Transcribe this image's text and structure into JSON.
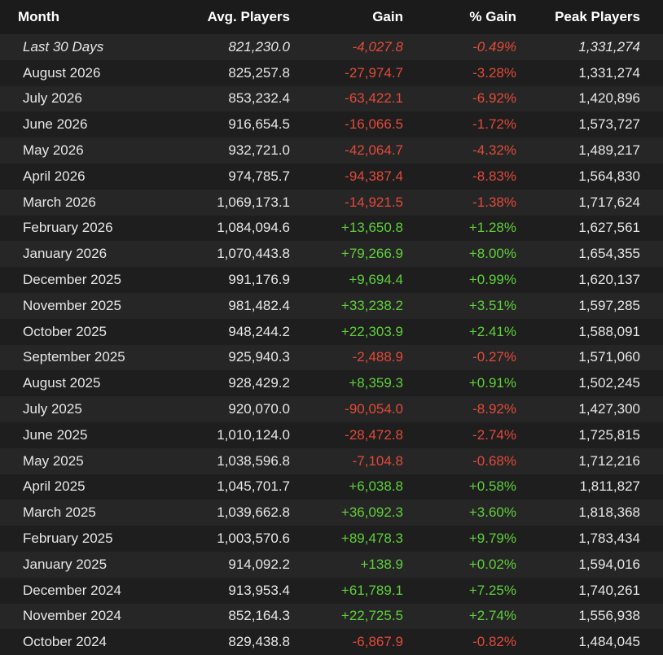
{
  "table": {
    "headers": {
      "month": "Month",
      "avg": "Avg. Players",
      "gain": "Gain",
      "pct": "% Gain",
      "peak": "Peak Players"
    },
    "rows": [
      {
        "month": "Last 30 Days",
        "avg": "821,230.0",
        "gain": "-4,027.8",
        "pct": "-0.49%",
        "peak": "1,331,274",
        "trend": "neg",
        "italic": true
      },
      {
        "month": "August 2026",
        "avg": "825,257.8",
        "gain": "-27,974.7",
        "pct": "-3.28%",
        "peak": "1,331,274",
        "trend": "neg"
      },
      {
        "month": "July 2026",
        "avg": "853,232.4",
        "gain": "-63,422.1",
        "pct": "-6.92%",
        "peak": "1,420,896",
        "trend": "neg"
      },
      {
        "month": "June 2026",
        "avg": "916,654.5",
        "gain": "-16,066.5",
        "pct": "-1.72%",
        "peak": "1,573,727",
        "trend": "neg"
      },
      {
        "month": "May 2026",
        "avg": "932,721.0",
        "gain": "-42,064.7",
        "pct": "-4.32%",
        "peak": "1,489,217",
        "trend": "neg"
      },
      {
        "month": "April 2026",
        "avg": "974,785.7",
        "gain": "-94,387.4",
        "pct": "-8.83%",
        "peak": "1,564,830",
        "trend": "neg"
      },
      {
        "month": "March 2026",
        "avg": "1,069,173.1",
        "gain": "-14,921.5",
        "pct": "-1.38%",
        "peak": "1,717,624",
        "trend": "neg"
      },
      {
        "month": "February 2026",
        "avg": "1,084,094.6",
        "gain": "+13,650.8",
        "pct": "+1.28%",
        "peak": "1,627,561",
        "trend": "pos"
      },
      {
        "month": "January 2026",
        "avg": "1,070,443.8",
        "gain": "+79,266.9",
        "pct": "+8.00%",
        "peak": "1,654,355",
        "trend": "pos"
      },
      {
        "month": "December 2025",
        "avg": "991,176.9",
        "gain": "+9,694.4",
        "pct": "+0.99%",
        "peak": "1,620,137",
        "trend": "pos"
      },
      {
        "month": "November 2025",
        "avg": "981,482.4",
        "gain": "+33,238.2",
        "pct": "+3.51%",
        "peak": "1,597,285",
        "trend": "pos"
      },
      {
        "month": "October 2025",
        "avg": "948,244.2",
        "gain": "+22,303.9",
        "pct": "+2.41%",
        "peak": "1,588,091",
        "trend": "pos"
      },
      {
        "month": "September 2025",
        "avg": "925,940.3",
        "gain": "-2,488.9",
        "pct": "-0.27%",
        "peak": "1,571,060",
        "trend": "neg"
      },
      {
        "month": "August 2025",
        "avg": "928,429.2",
        "gain": "+8,359.3",
        "pct": "+0.91%",
        "peak": "1,502,245",
        "trend": "pos"
      },
      {
        "month": "July 2025",
        "avg": "920,070.0",
        "gain": "-90,054.0",
        "pct": "-8.92%",
        "peak": "1,427,300",
        "trend": "neg"
      },
      {
        "month": "June 2025",
        "avg": "1,010,124.0",
        "gain": "-28,472.8",
        "pct": "-2.74%",
        "peak": "1,725,815",
        "trend": "neg"
      },
      {
        "month": "May 2025",
        "avg": "1,038,596.8",
        "gain": "-7,104.8",
        "pct": "-0.68%",
        "peak": "1,712,216",
        "trend": "neg"
      },
      {
        "month": "April 2025",
        "avg": "1,045,701.7",
        "gain": "+6,038.8",
        "pct": "+0.58%",
        "peak": "1,811,827",
        "trend": "pos"
      },
      {
        "month": "March 2025",
        "avg": "1,039,662.8",
        "gain": "+36,092.3",
        "pct": "+3.60%",
        "peak": "1,818,368",
        "trend": "pos"
      },
      {
        "month": "February 2025",
        "avg": "1,003,570.6",
        "gain": "+89,478.3",
        "pct": "+9.79%",
        "peak": "1,783,434",
        "trend": "pos"
      },
      {
        "month": "January 2025",
        "avg": "914,092.2",
        "gain": "+138.9",
        "pct": "+0.02%",
        "peak": "1,594,016",
        "trend": "pos"
      },
      {
        "month": "December 2024",
        "avg": "913,953.4",
        "gain": "+61,789.1",
        "pct": "+7.25%",
        "peak": "1,740,261",
        "trend": "pos"
      },
      {
        "month": "November 2024",
        "avg": "852,164.3",
        "gain": "+22,725.5",
        "pct": "+2.74%",
        "peak": "1,556,938",
        "trend": "pos"
      },
      {
        "month": "October 2024",
        "avg": "829,438.8",
        "gain": "-6,867.9",
        "pct": "-0.82%",
        "peak": "1,484,045",
        "trend": "neg"
      }
    ]
  },
  "colors": {
    "positive": "#5fcf3a",
    "negative": "#e04a3a",
    "row_odd": "#262626",
    "row_even": "#1e1e1e"
  }
}
